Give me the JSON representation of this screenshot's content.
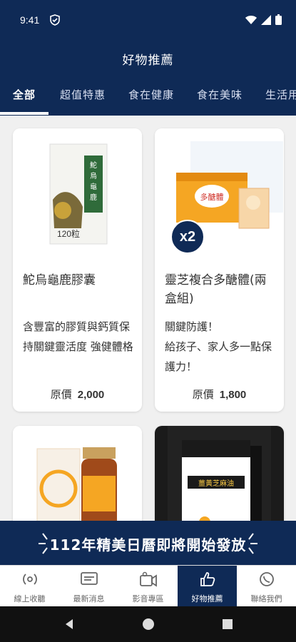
{
  "status_bar": {
    "time": "9:41"
  },
  "header": {
    "title": "好物推薦"
  },
  "tabs": [
    {
      "label": "全部"
    },
    {
      "label": "超值特惠"
    },
    {
      "label": "食在健康"
    },
    {
      "label": "食在美味"
    },
    {
      "label": "生活用"
    }
  ],
  "products": [
    {
      "title": "鮀烏龜鹿膠囊",
      "description": "含豐富的膠質與鈣質保持關鍵靈活度 強健體格",
      "price_label": "原價",
      "price": "2,000",
      "badge": "",
      "image_text": "鮀烏龜鹿膠囊",
      "image_count": "120粒"
    },
    {
      "title": "靈芝複合多醣體(兩盒組)",
      "description": "關鍵防護！\n給孩子、家人多一點保護力！",
      "price_label": "原價",
      "price": "1,800",
      "badge": "x2",
      "image_text": "多醣體"
    },
    {
      "title": "",
      "description": "",
      "price_label": "",
      "price": "",
      "badge": ""
    },
    {
      "title": "",
      "description": "",
      "price_label": "",
      "price": "",
      "badge": "",
      "image_text": "薑黃芝麻油"
    }
  ],
  "banner": {
    "text": "112年精美日曆即將開始發放"
  },
  "bottom_nav": [
    {
      "label": "線上收聽",
      "icon": "radio-icon"
    },
    {
      "label": "最新消息",
      "icon": "news-icon"
    },
    {
      "label": "影音專區",
      "icon": "video-icon"
    },
    {
      "label": "好物推薦",
      "icon": "thumbs-up-icon",
      "active": true
    },
    {
      "label": "聯絡我們",
      "icon": "whatsapp-icon"
    }
  ],
  "colors": {
    "primary": "#0f2a56",
    "accent_green": "#2f6b3a",
    "orange": "#f5a623"
  }
}
